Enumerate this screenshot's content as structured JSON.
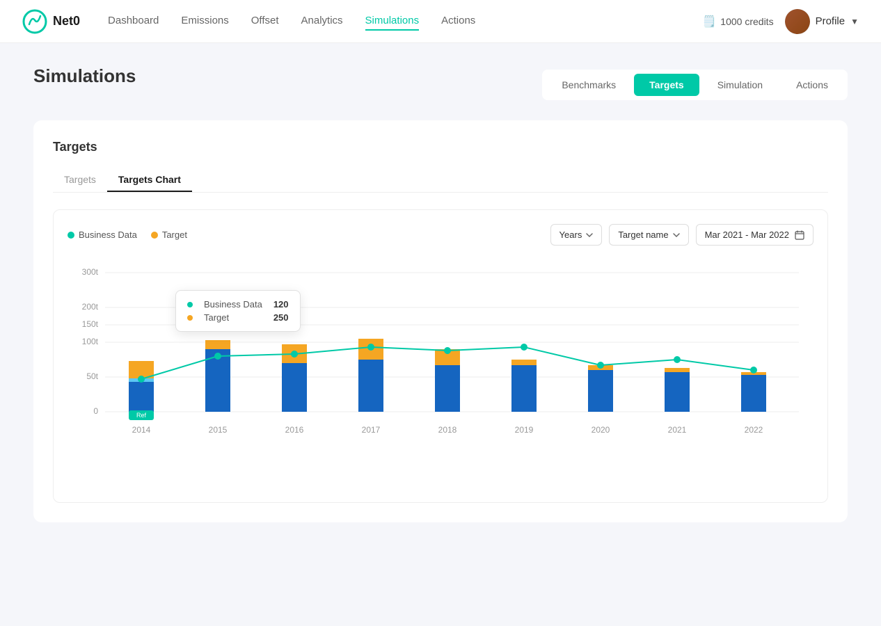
{
  "app": {
    "logo_text": "Net0",
    "credits_value": "1000 credits"
  },
  "nav": {
    "links": [
      {
        "label": "Dashboard",
        "active": false
      },
      {
        "label": "Emissions",
        "active": false
      },
      {
        "label": "Offset",
        "active": false
      },
      {
        "label": "Analytics",
        "active": false
      },
      {
        "label": "Simulations",
        "active": true
      },
      {
        "label": "Actions",
        "active": false
      }
    ]
  },
  "profile": {
    "name": "Profile"
  },
  "page": {
    "title": "Simulations"
  },
  "top_tabs": [
    {
      "label": "Benchmarks",
      "active": false
    },
    {
      "label": "Targets",
      "active": true
    },
    {
      "label": "Simulation",
      "active": false
    },
    {
      "label": "Actions",
      "active": false
    }
  ],
  "card": {
    "title": "Targets"
  },
  "sub_tabs": [
    {
      "label": "Targets",
      "active": false
    },
    {
      "label": "Targets Chart",
      "active": true
    }
  ],
  "chart": {
    "legend": [
      {
        "label": "Business Data",
        "color": "#00c9a7"
      },
      {
        "label": "Target",
        "color": "#f5a623"
      }
    ],
    "period_dropdown": "Years",
    "target_dropdown": "Target name",
    "date_range": "Mar 2021 - Mar 2022",
    "y_axis_labels": [
      "300t",
      "200t",
      "150t",
      "100t",
      "50t",
      "0"
    ],
    "x_axis_labels": [
      "2014",
      "2015",
      "2016",
      "2017",
      "2018",
      "2019",
      "2020",
      "2021",
      "2022"
    ],
    "ref_label": "Ref",
    "tooltip": {
      "items": [
        {
          "label": "Business Data",
          "value": "120",
          "color": "#00c9a7"
        },
        {
          "label": "Target",
          "value": "250",
          "color": "#f5a623"
        }
      ]
    }
  }
}
